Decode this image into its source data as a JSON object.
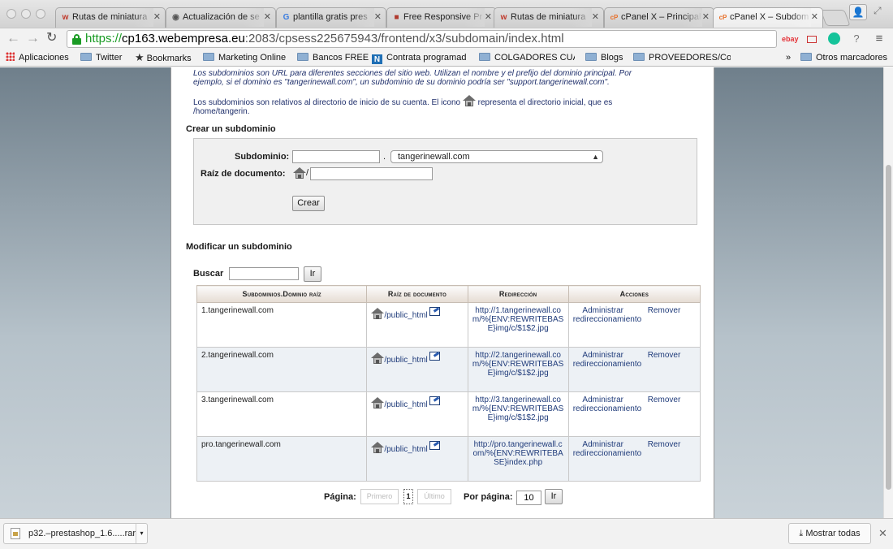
{
  "browser": {
    "tabs": [
      {
        "title": "Rutas de miniatura",
        "favicon": "w"
      },
      {
        "title": "Actualización de se",
        "favicon": "◉"
      },
      {
        "title": "plantilla gratis pres",
        "favicon": "G"
      },
      {
        "title": "Free Responsive Pr",
        "favicon": "■"
      },
      {
        "title": "Rutas de miniatura",
        "favicon": "w"
      },
      {
        "title": "cPanel X – Principal",
        "favicon": "cP"
      },
      {
        "title": "cPanel X – Subdom",
        "favicon": "cP"
      }
    ],
    "url": {
      "scheme": "https://",
      "host": "cp163.webempresa.eu",
      "path": ":2083/cpsess225675943/frontend/x3/subdomain/index.html"
    },
    "extensions": {
      "ebay": "ebay"
    },
    "bookmarks": [
      {
        "label": "Aplicaciones",
        "icon": "apps-grid-icon"
      },
      {
        "label": "Twitter",
        "icon": "folder-icon"
      },
      {
        "label": "Bookmarks",
        "icon": "star-icon"
      },
      {
        "label": "Marketing Online",
        "icon": "folder-icon"
      },
      {
        "label": "Bancos FREE",
        "icon": "folder-icon"
      },
      {
        "label": "Contrata programad",
        "icon": "n-icon"
      },
      {
        "label": "COLGADORES CUADI",
        "icon": "folder-icon"
      },
      {
        "label": "Blogs",
        "icon": "folder-icon"
      },
      {
        "label": "PROVEEDORES/Comp",
        "icon": "folder-icon"
      }
    ],
    "bookmarks_overflow": "»",
    "other_bookmarks": "Otros marcadores"
  },
  "page": {
    "intro_line1": "Los subdominios son URL para diferentes secciones del sitio web. Utilizan el nombre y el prefijo del dominio principal. Por",
    "intro_line2": "ejemplo, si el dominio es \"tangerinewall.com\", un subdominio de su dominio podría ser \"support.tangerinewall.com\".",
    "intro_line3_a": "Los subdominios son relativos al directorio de inicio de su cuenta. El icono",
    "intro_line3_b": "representa el directorio inicial, que es",
    "intro_line4": "/home/tangerin.",
    "create_title": "Crear un subdominio",
    "create": {
      "subdomain_label": "Subdominio:",
      "subdomain_value": "",
      "dot": ".",
      "domain_selected": "tangerinewall.com",
      "docroot_label": "Raíz de documento:",
      "docroot_prefix": "/",
      "docroot_value": "",
      "create_button": "Crear"
    },
    "modify_title": "Modificar un subdominio",
    "search_label": "Buscar",
    "search_value": "",
    "search_button": "Ir",
    "table": {
      "headers": [
        "Subdominios.Dominio raíz",
        "Raíz de documento",
        "Redirección",
        "Acciones"
      ],
      "rows": [
        {
          "domain": "1.tangerinewall.com",
          "root": "/public_html",
          "redirect": "http://1.tangerinewall.com/%{ENV:REWRITEBASE}img/c/$1$2.jpg",
          "manage": "Administrar redireccionamiento",
          "remove": "Remover"
        },
        {
          "domain": "2.tangerinewall.com",
          "root": "/public_html",
          "redirect": "http://2.tangerinewall.com/%{ENV:REWRITEBASE}img/c/$1$2.jpg",
          "manage": "Administrar redireccionamiento",
          "remove": "Remover"
        },
        {
          "domain": "3.tangerinewall.com",
          "root": "/public_html",
          "redirect": "http://3.tangerinewall.com/%{ENV:REWRITEBASE}img/c/$1$2.jpg",
          "manage": "Administrar redireccionamiento",
          "remove": "Remover"
        },
        {
          "domain": "pro.tangerinewall.com",
          "root": "/public_html",
          "redirect": "http://pro.tangerinewall.com/%{ENV:REWRITEBASE}index.php",
          "manage": "Administrar redireccionamiento",
          "remove": "Remover"
        }
      ]
    },
    "pager": {
      "page_label": "Página:",
      "first": "Primero",
      "current": "1",
      "last": "Último",
      "per_page_label": "Por página:",
      "per_page_value": "10",
      "go_button": "Ir"
    }
  },
  "downloads": {
    "file": "p32.–prestashop_1.6.....rar",
    "show_all": "Mostrar todas"
  }
}
